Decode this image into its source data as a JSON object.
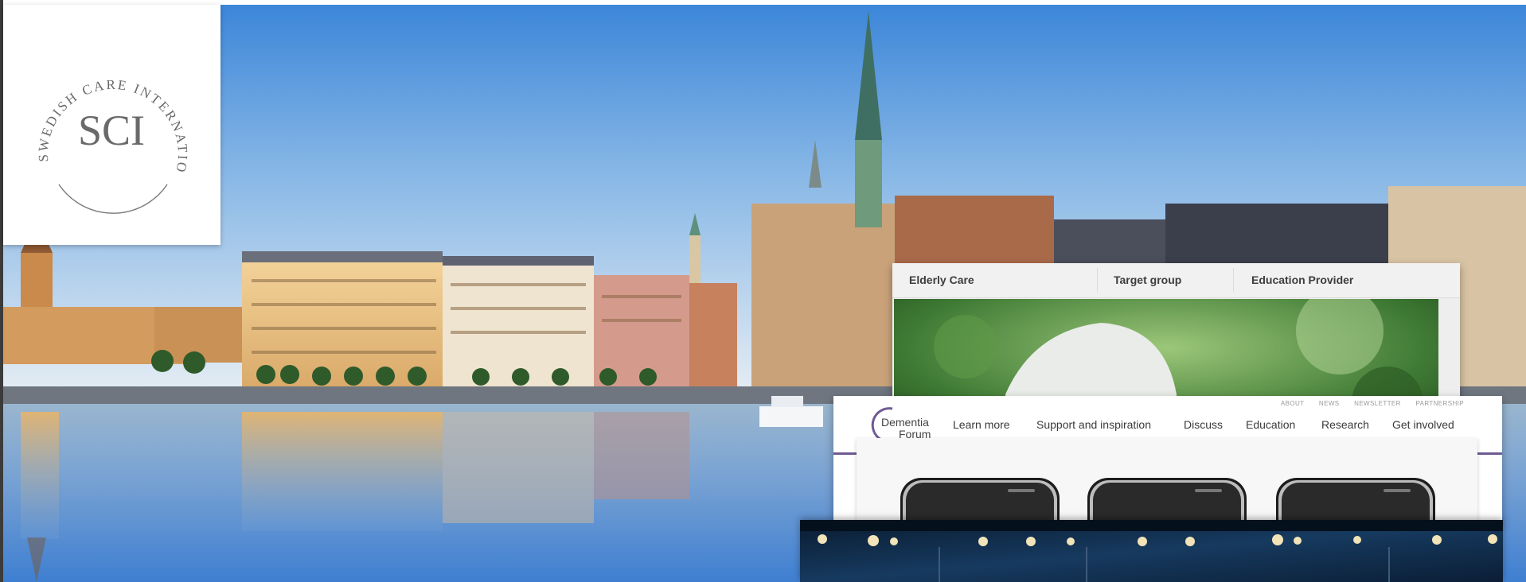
{
  "logo": {
    "arc_text": "SWEDISH CARE INTERNATIONAL",
    "monogram": "SCI"
  },
  "elderly_card": {
    "menu": [
      "Elderly Care",
      "Target group",
      "Education Provider"
    ]
  },
  "dementia_card": {
    "brand": {
      "line1": "Dementia",
      "line2": "Forum"
    },
    "top_links": [
      "ABOUT",
      "NEWS",
      "NEWSLETTER",
      "PARTNERSHIP"
    ],
    "nav": [
      "Learn more",
      "Support and inspiration",
      "Discuss",
      "Education",
      "Research",
      "Get involved"
    ],
    "accent_color": "#6f5a93"
  },
  "colors": {
    "sky_top": "#4f8fd6",
    "sky_bottom": "#d9e6f2",
    "water": "#7ea6d6"
  }
}
